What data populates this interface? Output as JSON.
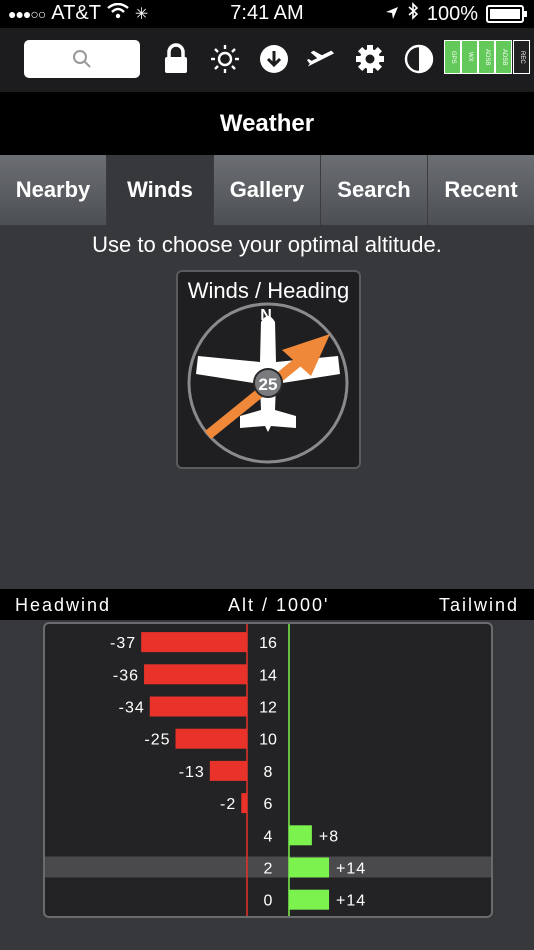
{
  "status_bar": {
    "carrier": "AT&T",
    "time": "7:41 AM",
    "battery": "100%"
  },
  "toolbar": {
    "icons": [
      "search-icon",
      "lock-icon",
      "brightness-icon",
      "download-icon",
      "airplane-icon",
      "gear-icon",
      "contrast-icon"
    ],
    "status_indicators": [
      "GPS",
      "WX",
      "ADSB",
      "ADSB",
      "REC"
    ],
    "indicator_color": "#63c95a"
  },
  "page_title": "Weather",
  "tabs": [
    {
      "label": "Nearby",
      "active": false
    },
    {
      "label": "Winds",
      "active": true
    },
    {
      "label": "Gallery",
      "active": false
    },
    {
      "label": "Search",
      "active": false
    },
    {
      "label": "Recent",
      "active": false
    }
  ],
  "subtitle": "Use to choose your optimal altitude.",
  "wind_widget": {
    "label": "Winds / Heading",
    "north_label": "N",
    "wind_speed": "25",
    "arrow_color": "#f0883a"
  },
  "axis_header": {
    "left": "Headwind",
    "center": "Alt / 1000'",
    "right": "Tailwind"
  },
  "chart_data": {
    "type": "bar",
    "orientation": "horizontal",
    "categories": [
      "16",
      "14",
      "12",
      "10",
      "8",
      "6",
      "4",
      "2",
      "0"
    ],
    "values": [
      -37,
      -36,
      -34,
      -25,
      -13,
      -2,
      8,
      14,
      14
    ],
    "value_labels": [
      "-37",
      "-36",
      "-34",
      "-25",
      "-13",
      "-2",
      "+8",
      "+14",
      "+14"
    ],
    "xlabel": "",
    "ylabel": "Alt / 1000'",
    "headwind_color": "#e8322a",
    "tailwind_color": "#7cf24e",
    "highlighted_category": "2"
  }
}
